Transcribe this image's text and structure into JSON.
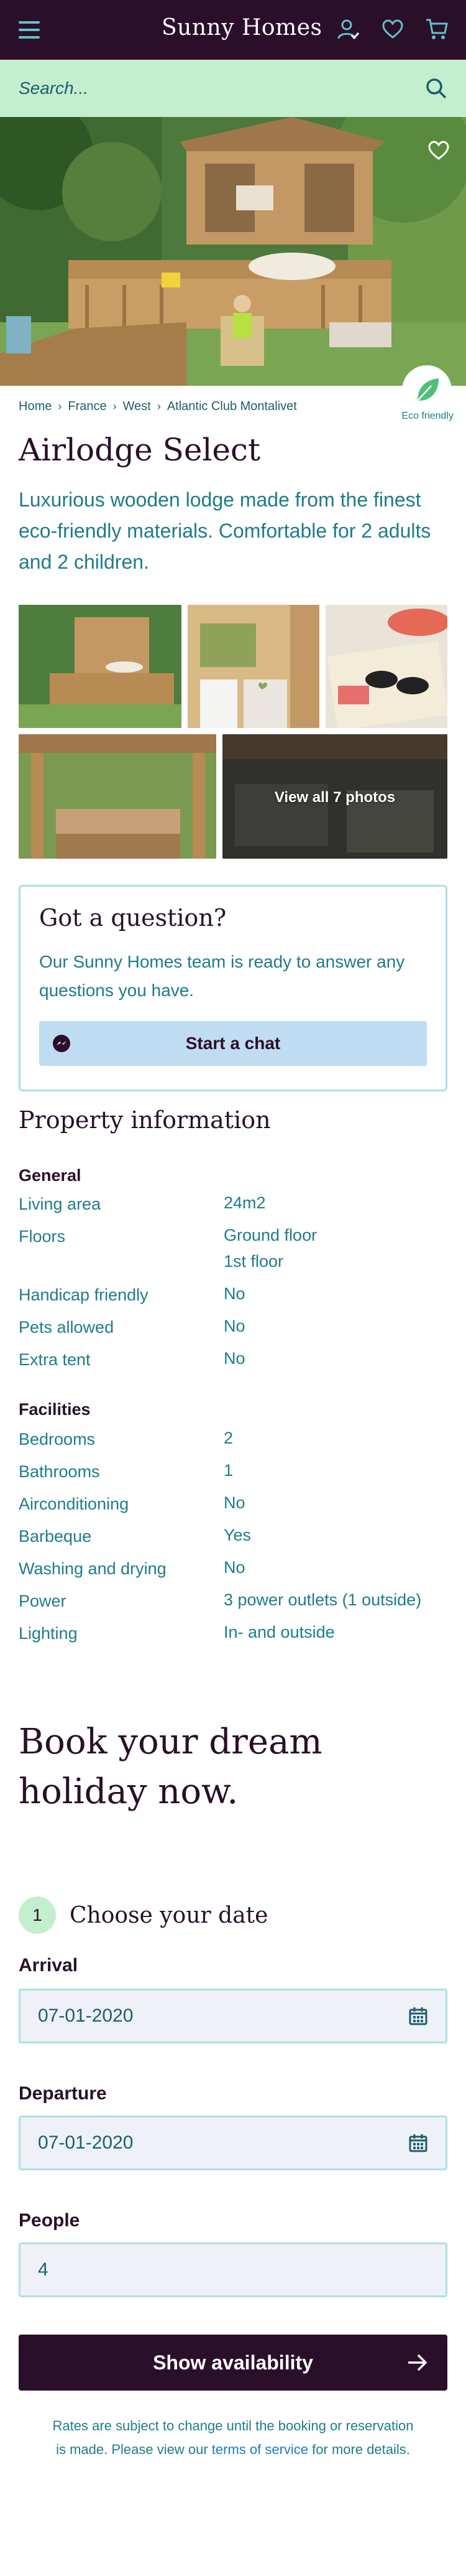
{
  "header": {
    "brand": "Sunny Homes",
    "icons": [
      "menu-icon",
      "account-icon",
      "heart-icon",
      "cart-icon"
    ]
  },
  "search": {
    "placeholder": "Search..."
  },
  "breadcrumb": [
    "Home",
    "France",
    "West",
    "Atlantic Club Montalivet"
  ],
  "eco": {
    "label": "Eco friendly"
  },
  "property": {
    "title": "Airlodge Select",
    "intro": "Luxurious wooden lodge made from the finest eco-friendly materials. Comfortable for 2 adults and 2 children.",
    "gallery_link": "View all 7 photos"
  },
  "question": {
    "title": "Got a question?",
    "text": "Our Sunny Homes team is ready to answer any questions you have.",
    "button": "Start a chat"
  },
  "info": {
    "heading": "Property information",
    "general_title": "General",
    "general": [
      {
        "label": "Living area",
        "value": "24m2"
      },
      {
        "label": "Floors",
        "value": "Ground floor",
        "value2": "1st floor"
      },
      {
        "label": "Handicap friendly",
        "value": "No"
      },
      {
        "label": "Pets allowed",
        "value": "No"
      },
      {
        "label": "Extra tent",
        "value": "No"
      }
    ],
    "facilities_title": "Facilities",
    "facilities": [
      {
        "label": "Bedrooms",
        "value": "2"
      },
      {
        "label": "Bathrooms",
        "value": "1"
      },
      {
        "label": "Airconditioning",
        "value": "No"
      },
      {
        "label": "Barbeque",
        "value": "Yes"
      },
      {
        "label": "Washing and drying",
        "value": "No"
      },
      {
        "label": "Power",
        "value": "3 power outlets (1 outside)"
      },
      {
        "label": "Lighting",
        "value": "In- and outside"
      }
    ]
  },
  "booking": {
    "heading": "Book your dream holiday now.",
    "step_number": "1",
    "step_label": "Choose your date",
    "arrival_label": "Arrival",
    "arrival_value": "07-01-2020",
    "departure_label": "Departure",
    "departure_value": "07-01-2020",
    "people_label": "People",
    "people_value": "4",
    "button": "Show availability",
    "note_text": "Rates are subject to change until the booking or reservation is made. Please view our",
    "note_link": "terms of service",
    "note_end": "for more details."
  },
  "colors": {
    "brand": "#2b0f2a",
    "accent": "#1e7c8a",
    "search_bg": "#c3efcf",
    "chat_btn": "#c0dcf3"
  }
}
